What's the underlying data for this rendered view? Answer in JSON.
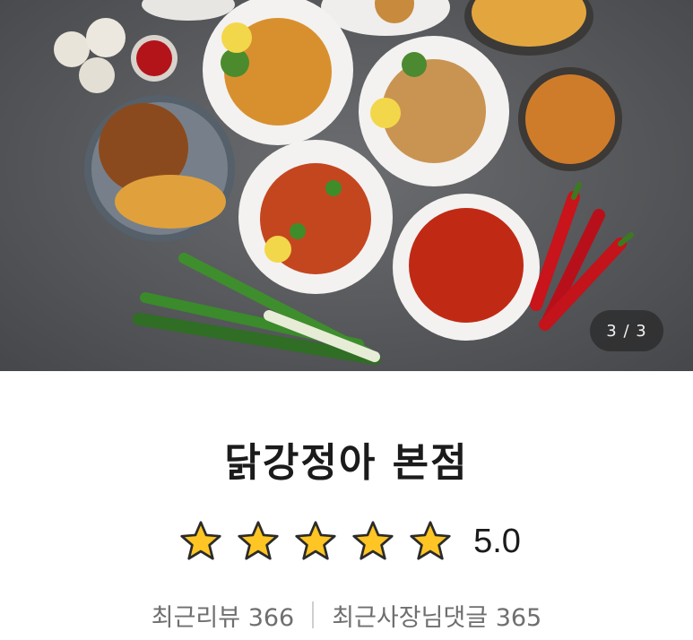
{
  "gallery": {
    "counter_text": "3 / 3"
  },
  "store": {
    "name": "닭강정아 본점",
    "rating_value": 5,
    "rating_max": 5,
    "rating_text": "5.0",
    "star_color": "#ffc524"
  },
  "stats": {
    "recent_reviews": "최근리뷰 366",
    "owner_replies": "최근사장님댓글 365"
  }
}
